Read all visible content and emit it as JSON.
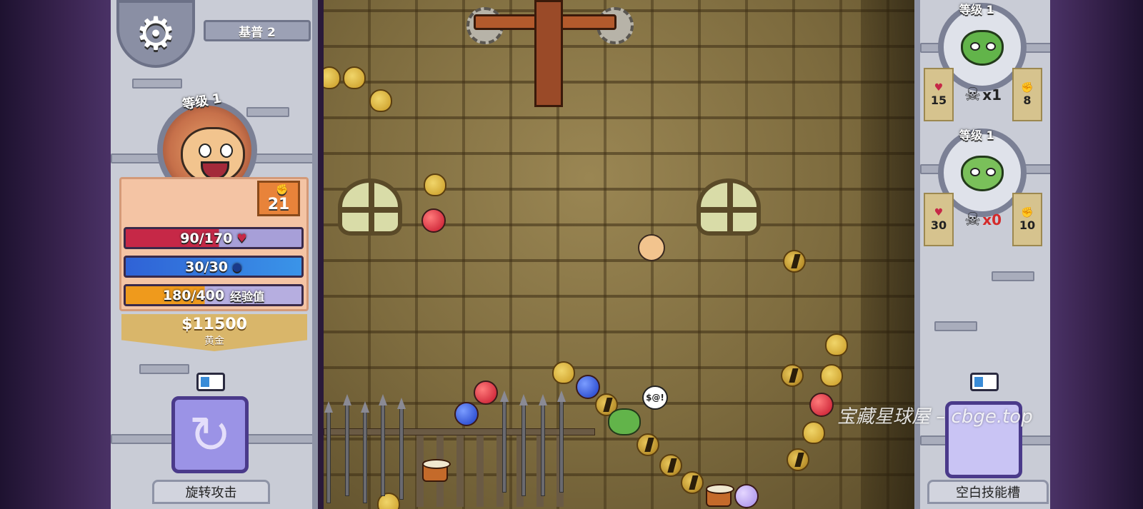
{
  "player": {
    "map_name": "基普 2",
    "level_label": "等级 1",
    "power": "21",
    "hp_text": "90/170",
    "hp_fraction": 0.53,
    "mp_text": "30/30",
    "mp_fraction": 1.0,
    "xp_text": "180/400",
    "xp_label": "经验值",
    "xp_fraction": 0.45,
    "gold_amount": "$11500",
    "gold_label": "黄金"
  },
  "skills": {
    "left_label": "旋转攻击",
    "left_icon": "spiral-icon",
    "right_label": "空白技能槽",
    "right_icon": "blank-book-icon"
  },
  "enemies": [
    {
      "level_label": "等级 1",
      "hp": "15",
      "kills": "x1",
      "power": "8",
      "kind": "goblin-dagger"
    },
    {
      "level_label": "等级 1",
      "hp": "30",
      "kills": "x0",
      "power": "10",
      "kind": "goblin-mohawk"
    }
  ],
  "dungeon": {
    "speech_text": "$@!"
  },
  "icons": {
    "settings": "gear-icon",
    "heart": "heart-icon",
    "mana": "mana-icon",
    "fist": "fist-icon",
    "skull": "skull-icon",
    "device": "phone-icon"
  },
  "colors": {
    "hp": "#c62847",
    "mp": "#2f62d6",
    "xp": "#ef9a1c",
    "gold": "#d9b66a"
  },
  "watermark": "宝藏星球屋 – cbge.top"
}
